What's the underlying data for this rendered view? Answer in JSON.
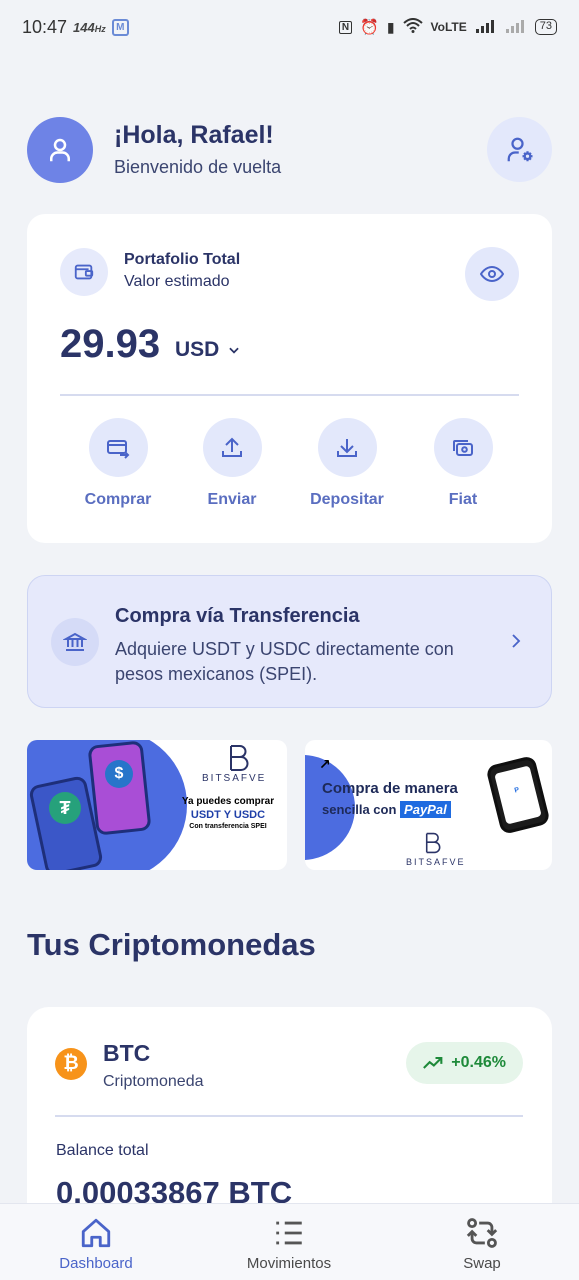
{
  "status_bar": {
    "time": "10:47",
    "refresh_rate": "144",
    "network": "VoLTE",
    "battery": "73"
  },
  "header": {
    "greeting": "¡Hola, Rafael!",
    "subtitle": "Bienvenido de vuelta"
  },
  "portfolio": {
    "title": "Portafolio Total",
    "subtitle": "Valor estimado",
    "amount": "29.93",
    "currency": "USD"
  },
  "actions": [
    {
      "label": "Comprar",
      "icon": "card-transfer-icon"
    },
    {
      "label": "Enviar",
      "icon": "upload-icon"
    },
    {
      "label": "Depositar",
      "icon": "download-icon"
    },
    {
      "label": "Fiat",
      "icon": "cash-icon"
    }
  ],
  "transfer_banner": {
    "title": "Compra vía Transferencia",
    "description": "Adquiere USDT y USDC directamente con pesos mexicanos (SPEI)."
  },
  "promos": [
    {
      "brand": "BITSAFVE",
      "line1": "Ya puedes comprar",
      "line2": "USDT Y USDC",
      "line3": "Con transferencia SPEI"
    },
    {
      "line1": "Compra de manera",
      "line2_prefix": "sencilla con",
      "line2_highlight": "PayPal",
      "brand": "BITSAFVE"
    }
  ],
  "section_title": "Tus Criptomonedas",
  "crypto": {
    "symbol": "BTC",
    "type": "Criptomoneda",
    "change": "+0.46%",
    "balance_label": "Balance total",
    "balance": "0.00033867 BTC"
  },
  "bottom_nav": [
    {
      "label": "Dashboard",
      "icon": "home-icon",
      "active": true
    },
    {
      "label": "Movimientos",
      "icon": "list-icon",
      "active": false
    },
    {
      "label": "Swap",
      "icon": "swap-icon",
      "active": false
    }
  ],
  "colors": {
    "primary": "#6e83e6",
    "accent_text": "#5a6ec0",
    "dark_text": "#2b3467",
    "positive": "#1e8a3a",
    "bitcoin": "#f7931a"
  }
}
